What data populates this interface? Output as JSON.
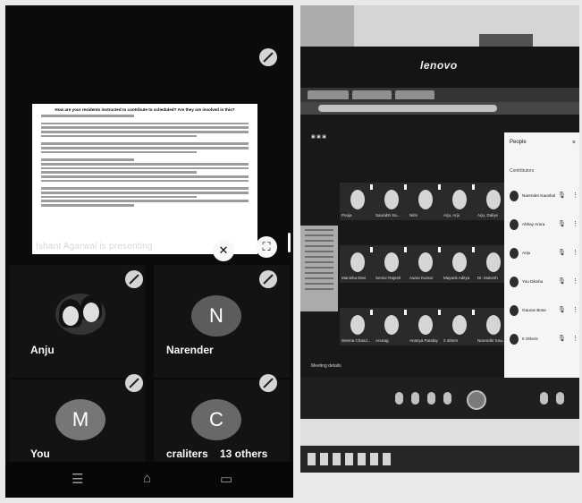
{
  "phone": {
    "presenter_label": "Ishant Agarwal is presenting",
    "document": {
      "title": "How are your residents instructed to contribute to scheduled? Are they are involved in this?"
    },
    "participants": [
      {
        "name": "Anju",
        "avatar": "photo"
      },
      {
        "name": "Narender",
        "avatar": "N"
      },
      {
        "name": "You",
        "avatar": "M"
      },
      {
        "name": "craliters",
        "avatar": "C",
        "extra": "13 others"
      }
    ],
    "nav_icons": [
      "menu-icon",
      "home-icon",
      "back-icon"
    ],
    "fullscreen_icon": "fullscreen-icon",
    "mute_icon": "mic-off-icon"
  },
  "laptop": {
    "brand": "lenovo",
    "people_panel": {
      "title": "People",
      "subtitle": "Contributors",
      "close": "×",
      "rows": [
        "Narender Kaushal",
        "Abhay Arora",
        "Anju",
        "You Diksha",
        "Gaurav Bose",
        "It Others"
      ]
    },
    "grid_labels": [
      "Pooja",
      "Saurabh Sa...",
      "Nitin",
      "Arju, Arju",
      "Arju, Daliye",
      "Manisha Devi",
      "Senior Rajesh",
      "Aarav Kumar",
      "Mayank Aditya",
      "Dr. Mukesh",
      "Seema Chand...",
      "Anurag",
      "Ananya Panday",
      "2 others",
      "Narender Kau..."
    ],
    "controls_label": "Meeting details"
  }
}
